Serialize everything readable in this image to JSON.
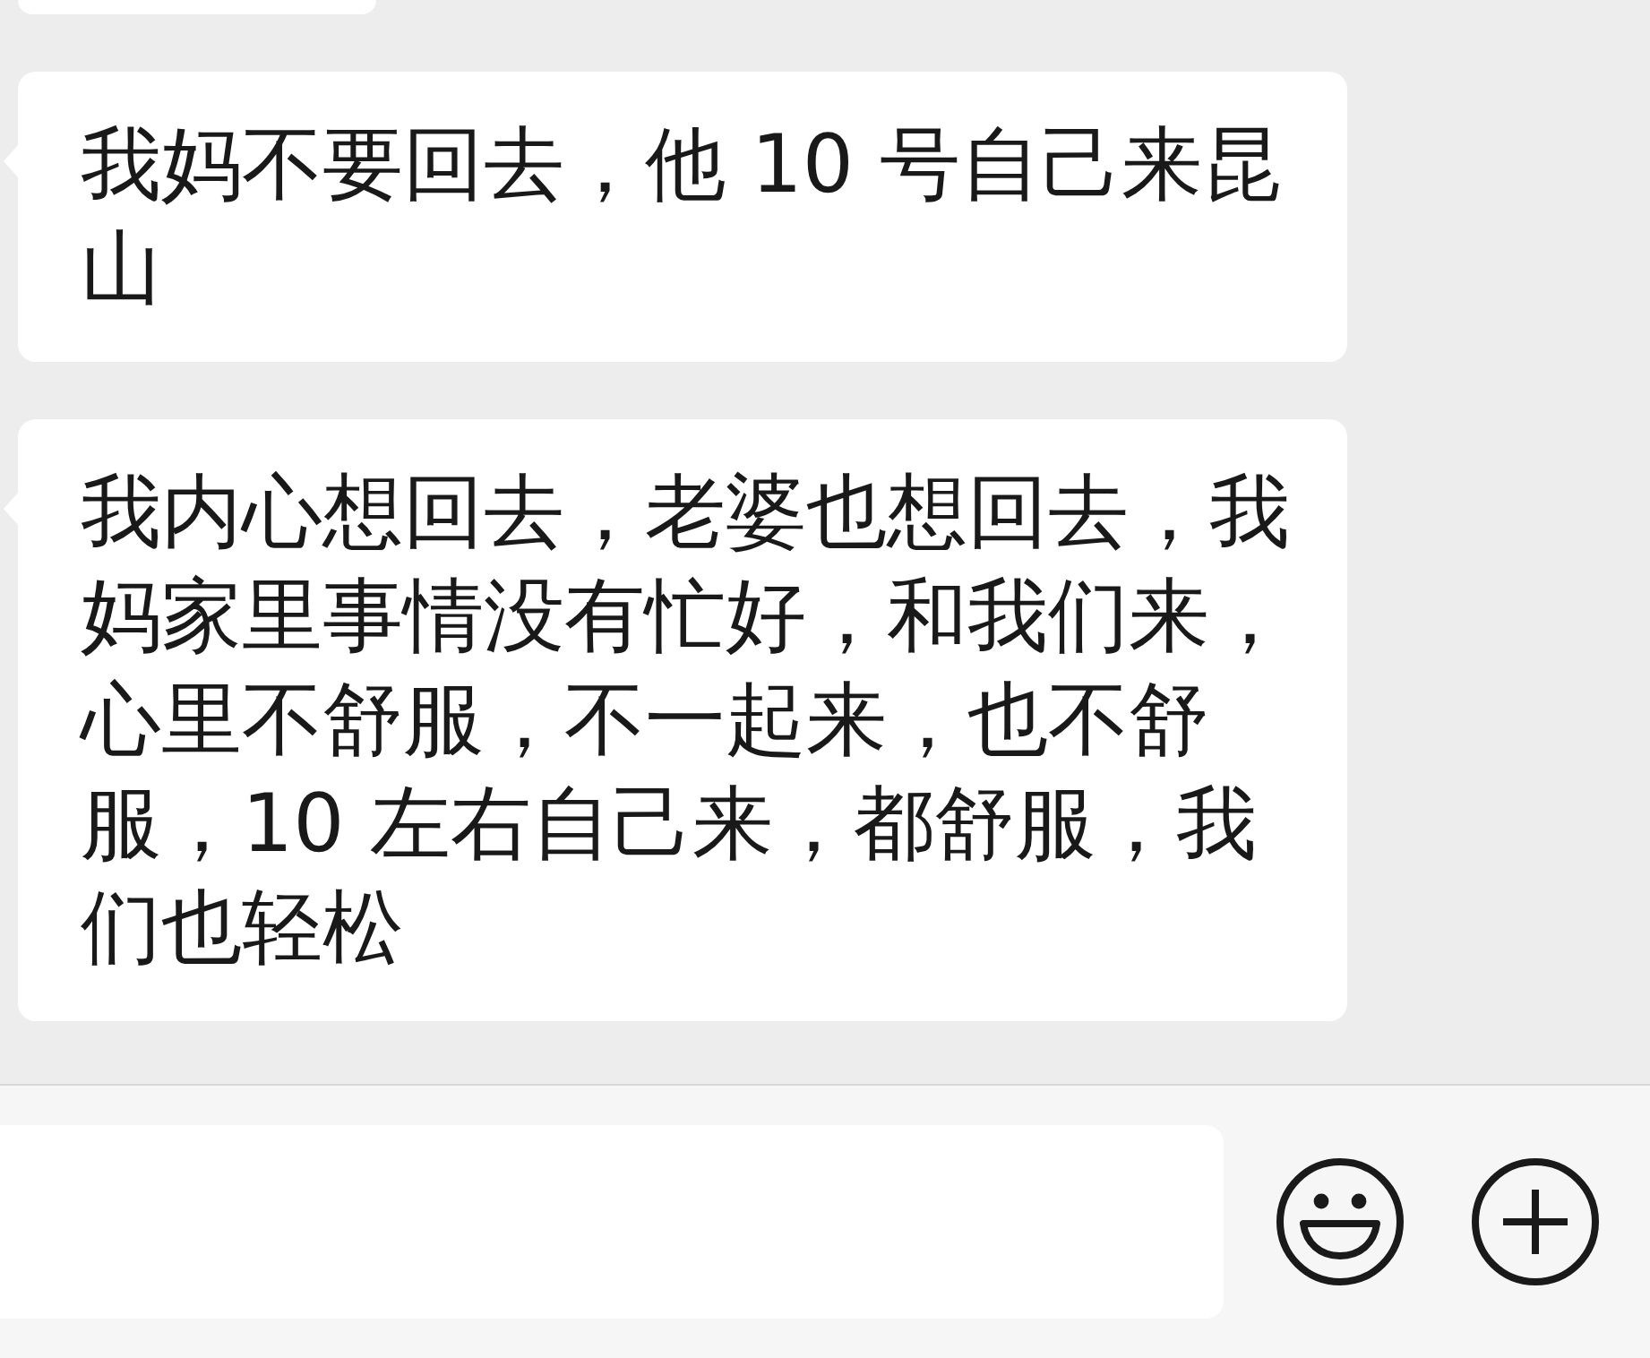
{
  "messages": [
    {
      "kind": "clipped"
    },
    {
      "kind": "text",
      "text": "我妈不要回去，他 10 号自己来昆山"
    },
    {
      "kind": "text",
      "text": "我内心想回去，老婆也想回去，我妈家里事情没有忙好，和我们来，心里不舒服，不一起来，也不舒服，10 左右自己来，都舒服，我们也轻松"
    }
  ]
}
